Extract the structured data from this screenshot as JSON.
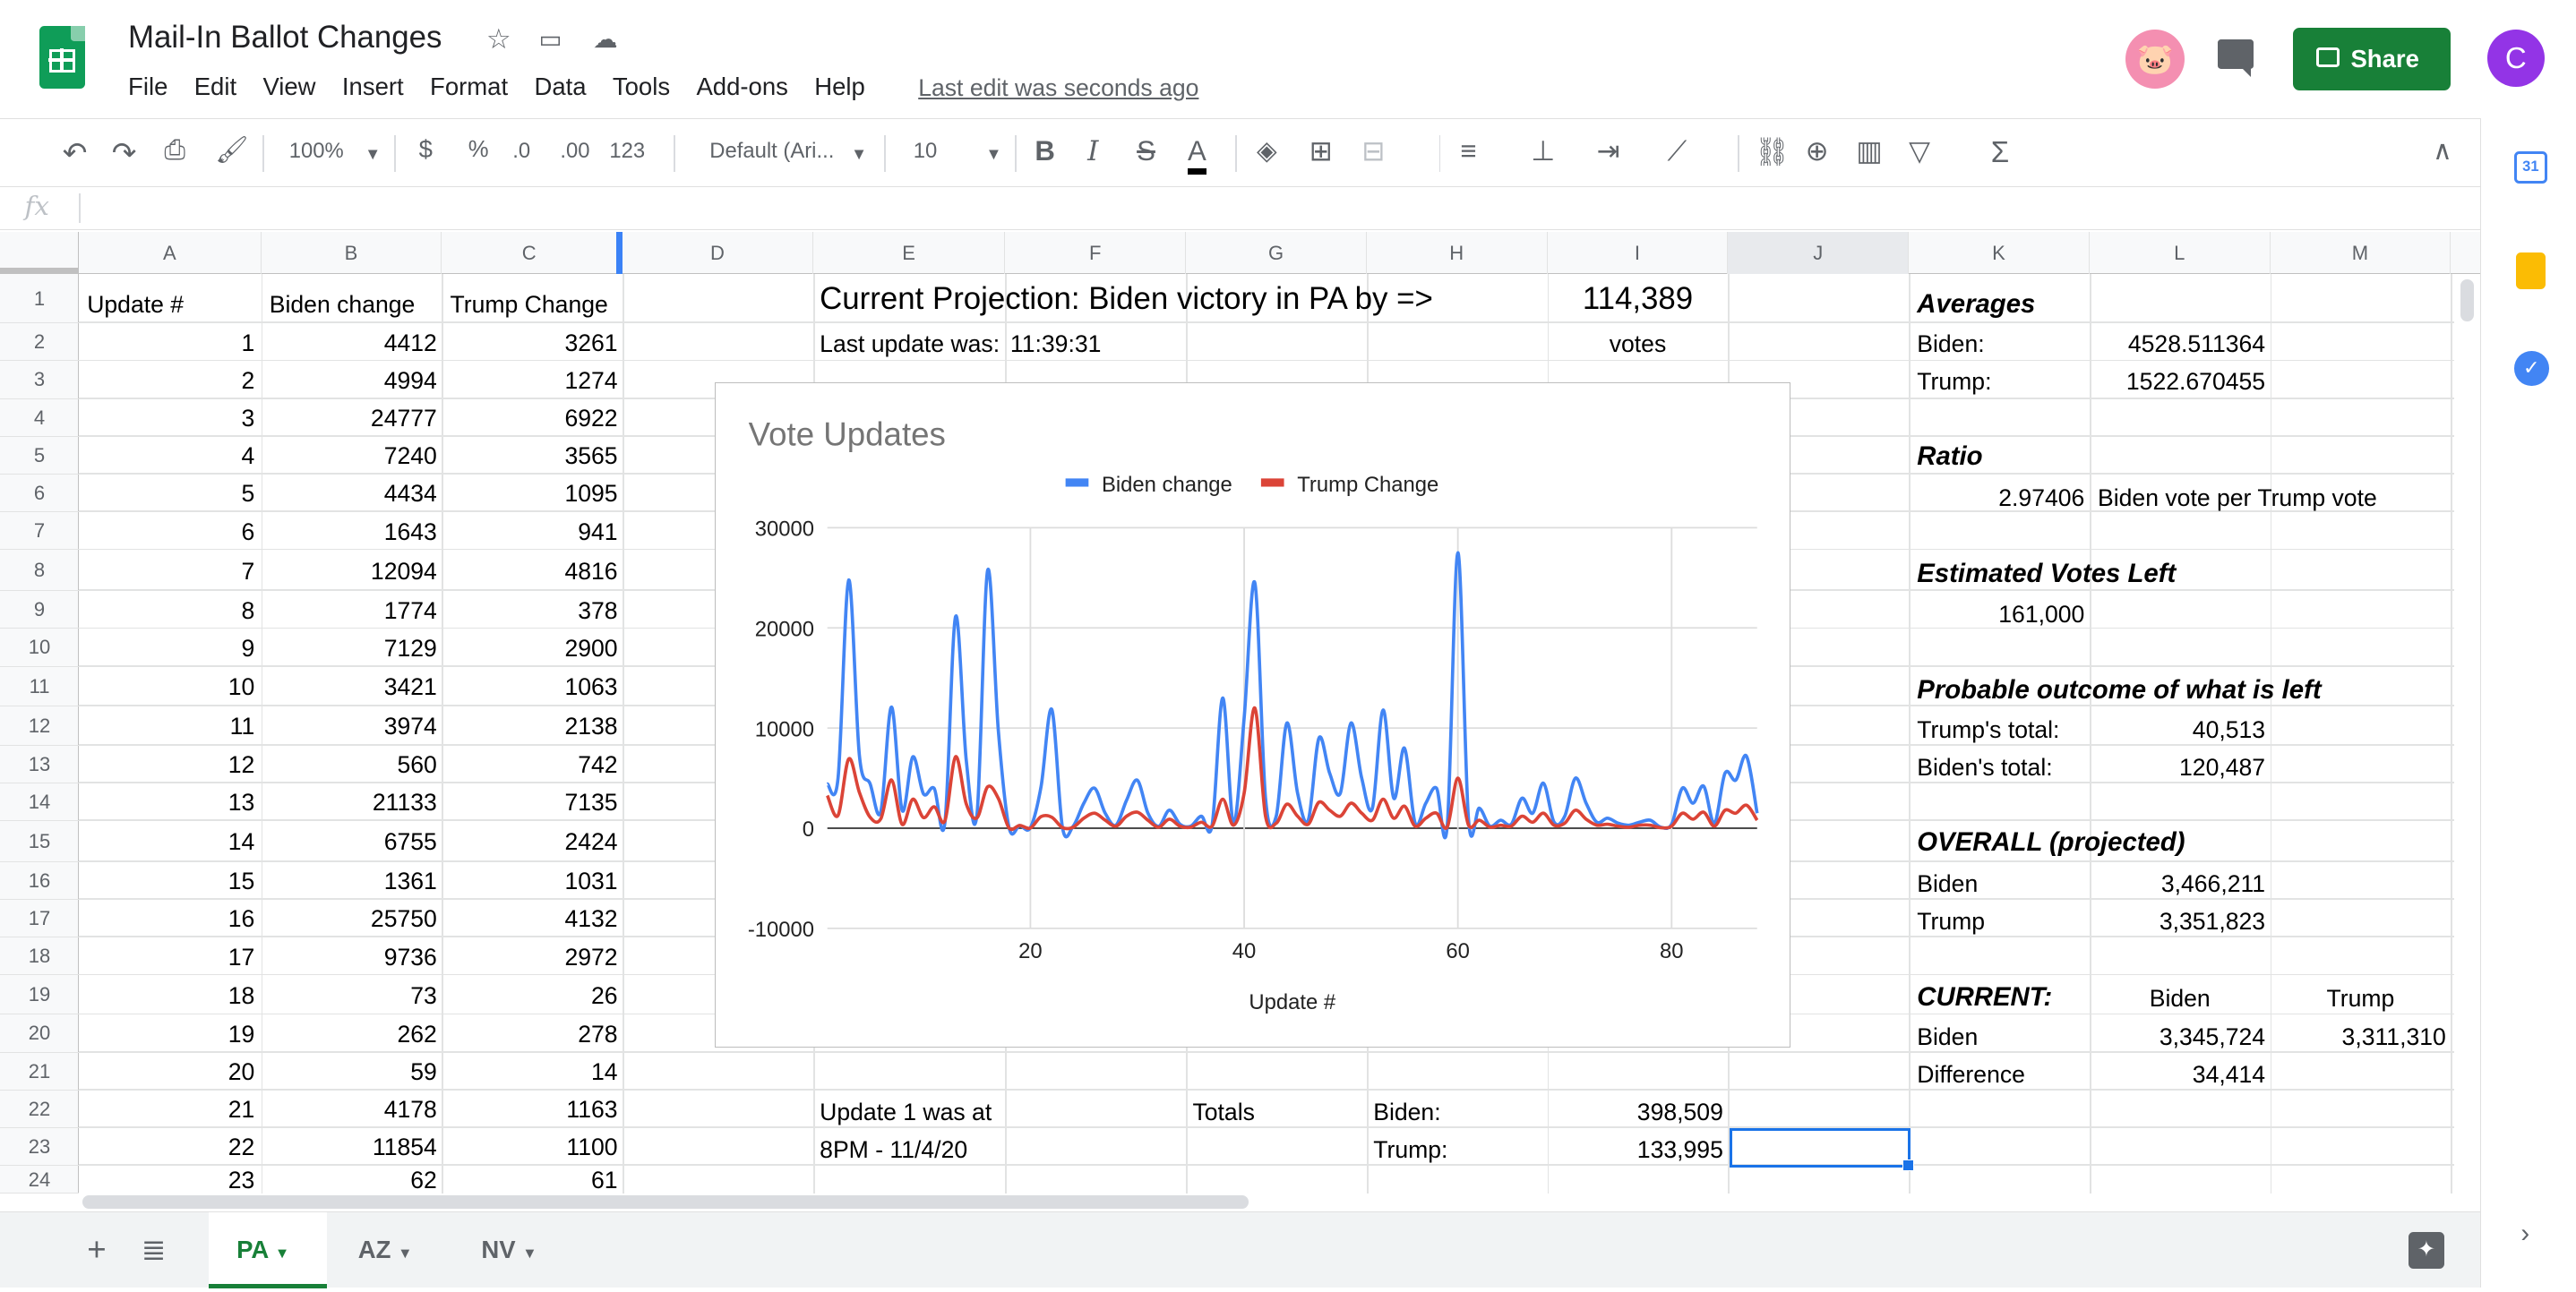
{
  "app": {
    "title": "Mail-In Ballot Changes",
    "menu": [
      "File",
      "Edit",
      "View",
      "Insert",
      "Format",
      "Data",
      "Tools",
      "Add-ons",
      "Help"
    ],
    "last_edit": "Last edit was seconds ago",
    "share_label": "Share",
    "user_initial": "C",
    "accent": "#188038"
  },
  "toolbar": {
    "zoom": "100%",
    "currency": "$",
    "percent": "%",
    "dec_less": ".0",
    "dec_more": ".00",
    "format_more": "123",
    "font": "Default (Ari...",
    "font_size": "10",
    "bold": "B",
    "italic": "I",
    "strike": "S",
    "text_color": "A",
    "sum": "Σ"
  },
  "formula_bar": {
    "fx": "fx",
    "value": ""
  },
  "columns": [
    "A",
    "B",
    "C",
    "D",
    "E",
    "F",
    "G",
    "H",
    "I",
    "J",
    "K",
    "L",
    "M"
  ],
  "rows": [
    "1",
    "2",
    "3",
    "4",
    "5",
    "6",
    "7",
    "8",
    "9",
    "10",
    "11",
    "12",
    "13",
    "14",
    "15",
    "16",
    "17",
    "18",
    "19",
    "20",
    "21",
    "22",
    "23",
    "24"
  ],
  "sheet": {
    "a1": "Update #",
    "b1": "Biden change",
    "c1": "Trump Change",
    "updates": [
      [
        "1",
        "4412",
        "3261"
      ],
      [
        "2",
        "4994",
        "1274"
      ],
      [
        "3",
        "24777",
        "6922"
      ],
      [
        "4",
        "7240",
        "3565"
      ],
      [
        "5",
        "4434",
        "1095"
      ],
      [
        "6",
        "1643",
        "941"
      ],
      [
        "7",
        "12094",
        "4816"
      ],
      [
        "8",
        "1774",
        "378"
      ],
      [
        "9",
        "7129",
        "2900"
      ],
      [
        "10",
        "3421",
        "1063"
      ],
      [
        "11",
        "3974",
        "2138"
      ],
      [
        "12",
        "560",
        "742"
      ],
      [
        "13",
        "21133",
        "7135"
      ],
      [
        "14",
        "6755",
        "2424"
      ],
      [
        "15",
        "1361",
        "1031"
      ],
      [
        "16",
        "25750",
        "4132"
      ],
      [
        "17",
        "9736",
        "2972"
      ],
      [
        "18",
        "73",
        "26"
      ],
      [
        "19",
        "262",
        "278"
      ],
      [
        "20",
        "59",
        "14"
      ],
      [
        "21",
        "4178",
        "1163"
      ],
      [
        "22",
        "11854",
        "1100"
      ],
      [
        "23",
        "62",
        "61"
      ]
    ],
    "projection_label": "Current Projection: Biden victory in PA by =>",
    "projection_value": "114,389",
    "last_update_label": "Last update was:",
    "last_update_time": "11:39:31",
    "votes_label": "votes",
    "update1_a": "Update 1 was at",
    "update1_b": "8PM - 11/4/20",
    "totals_label": "Totals",
    "biden_label": "Biden:",
    "trump_label": "Trump:",
    "biden_total": "398,509",
    "trump_total": "133,995",
    "averages": "Averages",
    "avg_biden_label": "Biden:",
    "avg_biden": "4528.511364",
    "avg_trump_label": "Trump:",
    "avg_trump": "1522.670455",
    "ratio": "Ratio",
    "ratio_value": "2.97406",
    "ratio_desc": "Biden vote per Trump vote",
    "est_left": "Estimated Votes Left",
    "est_left_value": "161,000",
    "probable": "Probable outcome of what is left",
    "trump_total_label": "Trump's total:",
    "trump_left": "40,513",
    "biden_total_label": "Biden's total:",
    "biden_left": "120,487",
    "overall": "OVERALL (projected)",
    "ov_biden_label": "Biden",
    "ov_biden": "3,466,211",
    "ov_trump_label": "Trump",
    "ov_trump": "3,351,823",
    "current": "CURRENT:",
    "cur_biden_hdr": "Biden",
    "cur_trump_hdr": "Trump",
    "cur_biden_label": "Biden",
    "cur_biden": "3,345,724",
    "cur_trump": "3,311,310",
    "diff_label": "Difference",
    "diff": "34,414"
  },
  "tabs": [
    "PA",
    "AZ",
    "NV"
  ],
  "chart_data": {
    "type": "line",
    "title": "Vote Updates",
    "xlabel": "Update #",
    "ylabel": "",
    "xlim": [
      1,
      88
    ],
    "ylim": [
      -10000,
      30000
    ],
    "yticks": [
      -10000,
      0,
      10000,
      20000,
      30000
    ],
    "xticks": [
      20,
      40,
      60,
      80
    ],
    "legend": "top",
    "series": [
      {
        "name": "Biden change",
        "color": "#4285f4",
        "values": [
          4412,
          4994,
          24777,
          7240,
          4434,
          1643,
          12094,
          1774,
          7129,
          3421,
          3974,
          560,
          21133,
          6755,
          1361,
          25750,
          9736,
          73,
          262,
          59,
          4178,
          11854,
          62,
          200,
          2500,
          4000,
          1500,
          300,
          2800,
          4800,
          1500,
          200,
          1800,
          400,
          200,
          1200,
          300,
          13000,
          500,
          11000,
          24500,
          3000,
          1200,
          10500,
          3500,
          800,
          9000,
          5500,
          3500,
          10500,
          5000,
          2000,
          11800,
          3000,
          8000,
          500,
          2500,
          4000,
          200,
          27500,
          800,
          2000,
          200,
          800,
          400,
          3000,
          1500,
          4500,
          600,
          1200,
          5000,
          2500,
          600,
          1000,
          500,
          300,
          600,
          800,
          100,
          400,
          4000,
          2500,
          4200,
          500,
          5500,
          4800,
          7200,
          1500
        ]
      },
      {
        "name": "Trump Change",
        "color": "#db4437",
        "values": [
          3261,
          1274,
          6922,
          3565,
          1095,
          941,
          4816,
          378,
          2900,
          1063,
          2138,
          742,
          7135,
          2424,
          1031,
          4132,
          2972,
          26,
          278,
          14,
          1163,
          1100,
          61,
          100,
          1000,
          1500,
          800,
          200,
          1200,
          1600,
          800,
          100,
          900,
          200,
          100,
          600,
          200,
          2900,
          300,
          3500,
          12000,
          1200,
          500,
          2400,
          1200,
          400,
          2600,
          1800,
          1200,
          2500,
          1500,
          800,
          2900,
          1000,
          2200,
          200,
          1000,
          1500,
          100,
          5000,
          300,
          800,
          100,
          300,
          200,
          1200,
          600,
          1500,
          300,
          500,
          1800,
          900,
          300,
          400,
          200,
          100,
          300,
          300,
          50,
          200,
          1500,
          900,
          1600,
          200,
          1800,
          1500,
          2300,
          800
        ]
      }
    ]
  }
}
